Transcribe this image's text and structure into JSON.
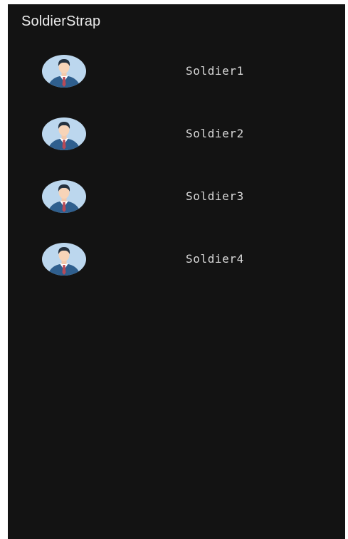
{
  "app": {
    "title": "SoldierStrap"
  },
  "soldiers": [
    {
      "label": "Soldier1",
      "icon": "person-avatar-icon"
    },
    {
      "label": "Soldier2",
      "icon": "person-avatar-icon"
    },
    {
      "label": "Soldier3",
      "icon": "person-avatar-icon"
    },
    {
      "label": "Soldier4",
      "icon": "person-avatar-icon"
    }
  ],
  "colors": {
    "background": "#131313",
    "title_text": "#ececec",
    "label_text": "#d8d8d8",
    "avatar_bg": "#bcd7ee",
    "suit": "#2f5f8e",
    "tie": "#b84a57"
  }
}
